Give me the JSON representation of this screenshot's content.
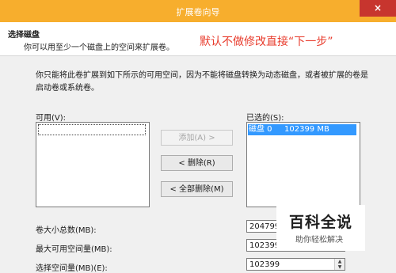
{
  "window": {
    "title": "扩展卷向导",
    "close_label": "×"
  },
  "header": {
    "title": "选择磁盘",
    "subtitle": "你可以用至少一个磁盘上的空间来扩展卷。",
    "annotation": "默认不做修改直接“下一步”"
  },
  "description": "你只能将此卷扩展到如下所示的可用空间，因为不能将磁盘转换为动态磁盘，或者被扩展的卷是启动卷或系统卷。",
  "available": {
    "label": "可用(V):",
    "items": []
  },
  "selected": {
    "label": "已选的(S):",
    "items": [
      {
        "disk": "磁盘 0",
        "size": "102399 MB"
      }
    ]
  },
  "buttons": {
    "add": "添加(A) >",
    "remove": "< 删除(R)",
    "remove_all": "< 全部删除(M)"
  },
  "fields": {
    "total_size_label": "卷大小总数(MB):",
    "total_size_value": "204799",
    "max_available_label": "最大可用空间量(MB):",
    "max_available_value": "102399",
    "select_amount_label": "选择空间量(MB)(E):",
    "select_amount_value": "102399"
  },
  "watermark": {
    "title": "百科全说",
    "subtitle": "助你轻松解决"
  }
}
